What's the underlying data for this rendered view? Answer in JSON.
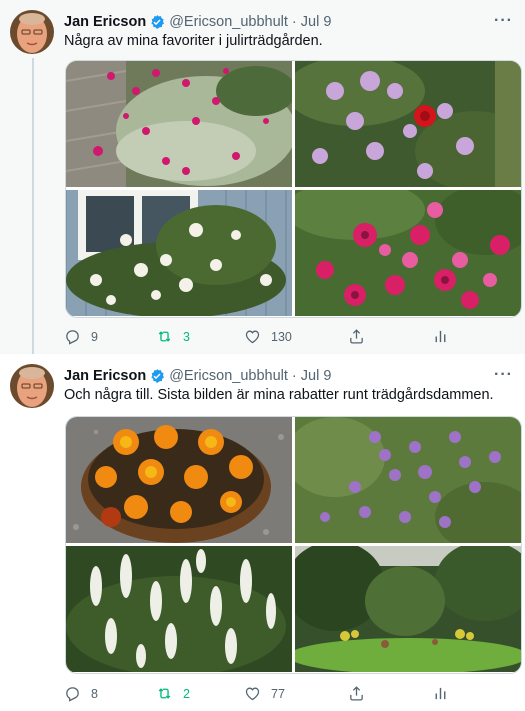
{
  "tweets": [
    {
      "name": "Jan Ericson",
      "handle": "@Ericson_ubbhult",
      "separator": "·",
      "date": "Jul 9",
      "more": "···",
      "text": "Några av mina favoriter i julirträdgården.",
      "photos": [
        "pink-campion-flowers",
        "mallow-and-red-rose",
        "white-rose-by-window",
        "sweet-william-pink-flowers"
      ],
      "replies": "9",
      "retweets": "3",
      "likes": "130"
    },
    {
      "name": "Jan Ericson",
      "handle": "@Ericson_ubbhult",
      "separator": "·",
      "date": "Jul 9",
      "more": "···",
      "text": "Och några till. Sista bilden är mina rabatter runt trädgårdsdammen.",
      "photos": [
        "marigolds-in-pot",
        "purple-bellflowers",
        "white-salvia",
        "garden-beds-by-pond"
      ],
      "replies": "8",
      "retweets": "2",
      "likes": "77"
    }
  ],
  "colors": {
    "verified": "#1d9bf0",
    "retweet": "#00ba7c",
    "muted": "#536471"
  },
  "icons": [
    "verified-badge-icon",
    "reply-icon",
    "retweet-icon",
    "like-icon",
    "share-icon",
    "analytics-icon"
  ]
}
